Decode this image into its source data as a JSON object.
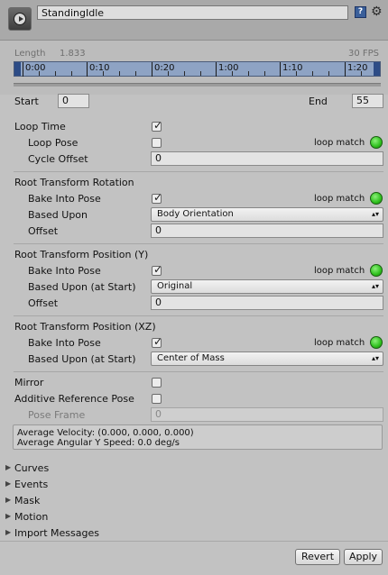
{
  "clip": {
    "name": "StandingIdle"
  },
  "header": {
    "help_icon": "?",
    "gear_icon": "⚙"
  },
  "timeline": {
    "length_label": "Length",
    "length_value": "1.833",
    "fps": "30 FPS",
    "ticks": [
      "0:00",
      "0:10",
      "0:20",
      "1:00",
      "1:10",
      "1:20"
    ]
  },
  "range": {
    "start_label": "Start",
    "start_value": "0",
    "end_label": "End",
    "end_value": "55"
  },
  "loop": {
    "loop_time_label": "Loop Time",
    "loop_time_checked": true,
    "loop_pose_label": "Loop Pose",
    "loop_pose_checked": false,
    "loop_match_label": "loop match",
    "cycle_offset_label": "Cycle Offset",
    "cycle_offset_value": "0"
  },
  "root_rotation": {
    "header": "Root Transform Rotation",
    "bake_label": "Bake Into Pose",
    "bake_checked": true,
    "loop_match_label": "loop match",
    "based_upon_label": "Based Upon",
    "based_upon_value": "Body Orientation",
    "offset_label": "Offset",
    "offset_value": "0"
  },
  "root_position_y": {
    "header": "Root Transform Position (Y)",
    "bake_label": "Bake Into Pose",
    "bake_checked": true,
    "loop_match_label": "loop match",
    "based_upon_label": "Based Upon (at Start)",
    "based_upon_value": "Original",
    "offset_label": "Offset",
    "offset_value": "0"
  },
  "root_position_xz": {
    "header": "Root Transform Position (XZ)",
    "bake_label": "Bake Into Pose",
    "bake_checked": true,
    "loop_match_label": "loop match",
    "based_upon_label": "Based Upon (at Start)",
    "based_upon_value": "Center of Mass"
  },
  "misc": {
    "mirror_label": "Mirror",
    "mirror_checked": false,
    "additive_label": "Additive Reference Pose",
    "additive_checked": false,
    "pose_frame_label": "Pose Frame",
    "pose_frame_value": "0"
  },
  "info": {
    "velocity": "Average Velocity: (0.000, 0.000, 0.000)",
    "angular": "Average Angular Y Speed: 0.0 deg/s"
  },
  "foldouts": [
    "Curves",
    "Events",
    "Mask",
    "Motion",
    "Import Messages"
  ],
  "buttons": {
    "revert": "Revert",
    "apply": "Apply"
  },
  "colors": {
    "loop_match_indicator": "#2ec01d",
    "timeline_bar": "#8ea3c4"
  }
}
